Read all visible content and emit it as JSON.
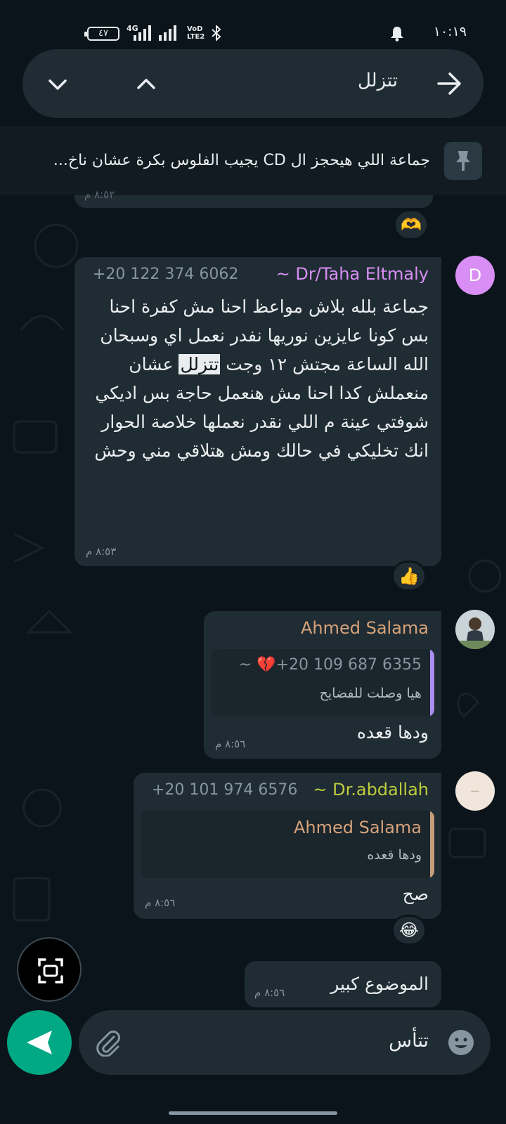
{
  "status_bar": {
    "time": "١٠:١٩",
    "battery": "٤٧",
    "network": "4G",
    "volte": "VoD LTE2"
  },
  "search": {
    "query": "تتزلل"
  },
  "pinned": {
    "text": "جماعة اللي هيحجز ال CD يجيب الفلوس بكرة عشان ناخ..."
  },
  "messages": [
    {
      "sender": "~ Dr/Taha Eltmaly",
      "phone": "+20 122 374 6062",
      "avatar_letter": "D",
      "text_before": "جماعة بلله بلاش مواعظ احنا مش كفرة احنا بس كونا عايزين نوريها نفدر نعمل اي وسبحان الله الساعة مجتش ١٢ وجت",
      "highlight": "تتزلل",
      "text_after": "عشان منعملش كدا احنا مش هنعمل حاجة بس اديكي شوفتي عينة م اللي نقدر نعملها خلاصة الحوار انك تخليكي في حالك ومش هتلاقي مني وحش",
      "time": "٨:٥٣ م",
      "reaction": "👍"
    },
    {
      "sender": "Ahmed Salama",
      "quote_sender": "~ 💔+20 109 687 6355",
      "quote_text": "هيا وصلت للفضايح",
      "text": "ودها قعده",
      "time": "٨:٥٦ م"
    },
    {
      "sender": "~ Dr.abdallah",
      "phone": "+20 101 974 6576",
      "quote_sender": "Ahmed Salama",
      "quote_text": "ودها قعده",
      "text": "صح",
      "time": "٨:٥٦ م",
      "reaction": "😂"
    },
    {
      "text": "الموضوع كبير",
      "time": "٨:٥٦ م"
    }
  ],
  "top_reaction": "🫶",
  "clipped_time": "٨:٥٢ م",
  "input": {
    "text": "تتأس"
  },
  "colors": {
    "background": "#0b141a",
    "bubble": "#202c33",
    "accent": "#00a884",
    "taha_name": "#d88ef5",
    "ahmed_name": "#d6a27a",
    "abdallah_name": "#bccc3c",
    "quote_bar_purple": "#a98ef0",
    "quote_bar_tan": "#c4a07a"
  }
}
